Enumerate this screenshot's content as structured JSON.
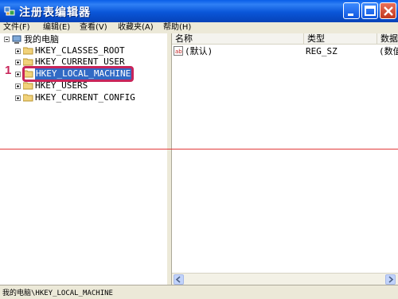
{
  "window": {
    "title": "注册表编辑器",
    "icon": "regedit-icon",
    "title_color": "#0a56d8"
  },
  "menu": {
    "items": [
      "文件(F)",
      "编辑(E)",
      "查看(V)",
      "收藏夹(A)",
      "帮助(H)"
    ]
  },
  "tree": {
    "root": "我的电脑",
    "items": [
      {
        "label": "HKEY_CLASSES_ROOT"
      },
      {
        "label": "HKEY_CURRENT_USER"
      },
      {
        "label": "HKEY_LOCAL_MACHINE",
        "selected": true
      },
      {
        "label": "HKEY_USERS"
      },
      {
        "label": "HKEY_CURRENT_CONFIG"
      }
    ]
  },
  "annotation": {
    "step_number": "1",
    "highlight_color": "#c8255a"
  },
  "list": {
    "columns": [
      "名称",
      "类型",
      "数据"
    ],
    "rows": [
      {
        "name": "(默认)",
        "type": "REG_SZ",
        "data": "(数值"
      }
    ]
  },
  "status": {
    "path": "我的电脑\\HKEY_LOCAL_MACHINE"
  },
  "colors": {
    "selection": "#316ac5",
    "guide_line": "#e23a3a"
  }
}
